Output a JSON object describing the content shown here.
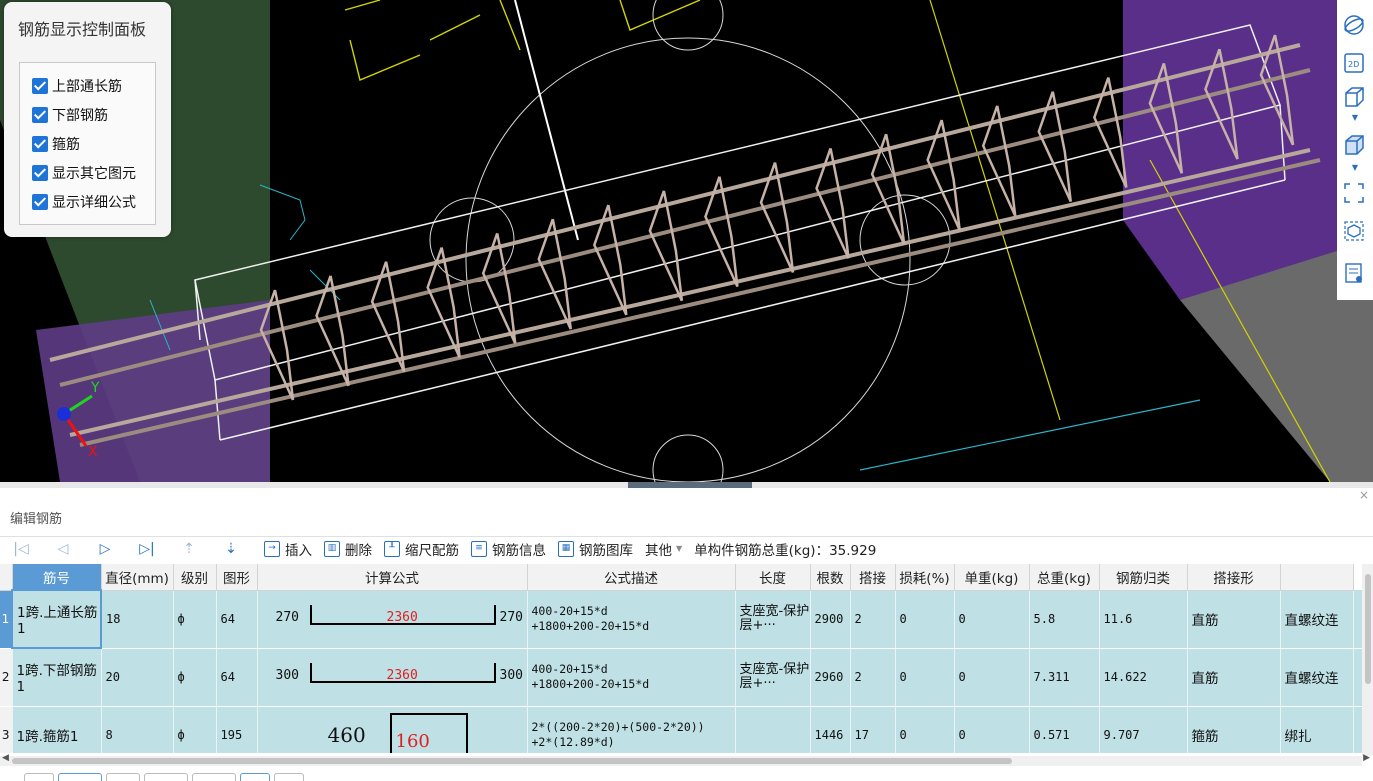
{
  "control_panel": {
    "title": "钢筋显示控制面板",
    "options": [
      {
        "label": "上部通长筋",
        "checked": true
      },
      {
        "label": "下部钢筋",
        "checked": true
      },
      {
        "label": "箍筋",
        "checked": true
      },
      {
        "label": "显示其它图元",
        "checked": true
      },
      {
        "label": "显示详细公式",
        "checked": true
      }
    ]
  },
  "viewport": {
    "axis_x": "X",
    "axis_y": "Y"
  },
  "right_toolbar": {
    "icons": [
      "orbit-icon",
      "2d-view-icon",
      "box-view-icon",
      "solid-view-icon",
      "fit-view-icon",
      "isolate-icon",
      "properties-icon"
    ],
    "label_2d": "2D"
  },
  "editor": {
    "title": "编辑钢筋",
    "toolbar": {
      "insert": "插入",
      "delete": "删除",
      "scale_rebar": "缩尺配筋",
      "rebar_info": "钢筋信息",
      "rebar_library": "钢筋图库",
      "other": "其他",
      "total_weight_label": "单构件钢筋总重(kg)：35.929"
    },
    "columns": [
      "筋号",
      "直径(mm)",
      "级别",
      "图形",
      "计算公式",
      "公式描述",
      "长度",
      "根数",
      "搭接",
      "损耗(%)",
      "单重(kg)",
      "总重(kg)",
      "钢筋归类",
      "搭接形"
    ],
    "rows": [
      {
        "num": "1",
        "name": "1跨.上通长筋1",
        "diameter": "18",
        "grade": "ф",
        "shape_no": "64",
        "shape_left": "270",
        "shape_mid": "2360",
        "shape_right": "270",
        "formula_line1": "400-20+15*d",
        "formula_line2": "+1800+200-20+15*d",
        "desc": "支座宽-保护层+···",
        "length": "2900",
        "count": "2",
        "lap": "0",
        "loss": "0",
        "unit_weight": "5.8",
        "total_weight": "11.6",
        "category": "直筋",
        "lap_type": "直螺纹连"
      },
      {
        "num": "2",
        "name": "1跨.下部钢筋1",
        "diameter": "20",
        "grade": "ф",
        "shape_no": "64",
        "shape_left": "300",
        "shape_mid": "2360",
        "shape_right": "300",
        "formula_line1": "400-20+15*d",
        "formula_line2": "+1800+200-20+15*d",
        "desc": "支座宽-保护层+···",
        "length": "2960",
        "count": "2",
        "lap": "0",
        "loss": "0",
        "unit_weight": "7.311",
        "total_weight": "14.622",
        "category": "直筋",
        "lap_type": "直螺纹连"
      },
      {
        "num": "3",
        "name": "1跨.箍筋1",
        "diameter": "8",
        "grade": "ф",
        "shape_no": "195",
        "shape_left": "460",
        "shape_mid": "160",
        "shape_right": "",
        "formula_line1": "2*((200-2*20)+(500-2*20))",
        "formula_line2": "+2*(12.89*d)",
        "desc": "",
        "length": "1446",
        "count": "17",
        "lap": "0",
        "loss": "0",
        "unit_weight": "0.571",
        "total_weight": "9.707",
        "category": "箍筋",
        "lap_type": "绑扎"
      }
    ]
  }
}
